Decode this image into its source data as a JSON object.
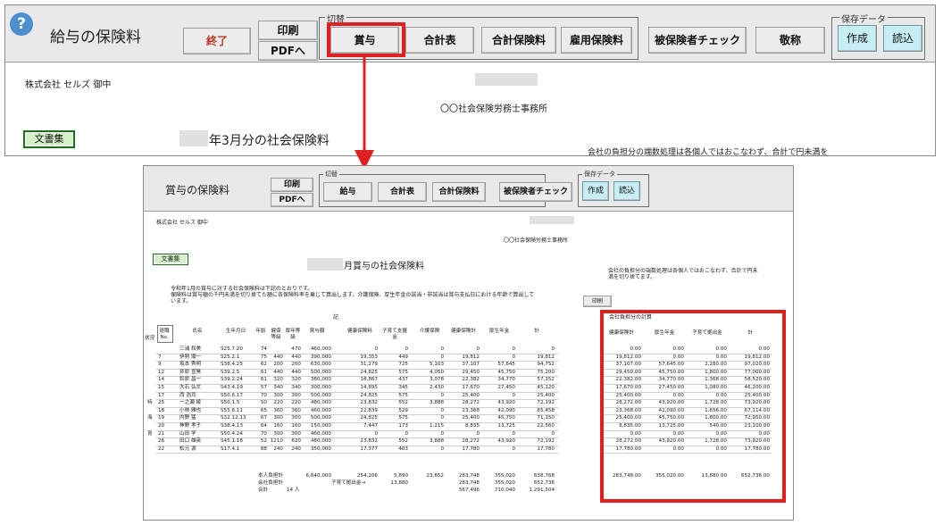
{
  "top": {
    "title": "給与の保険料",
    "help_icon": "?",
    "buttons": {
      "exit": "終了",
      "print": "印刷",
      "pdf": "PDFへ",
      "bonus": "賞与",
      "total_table": "合計表",
      "total_insurance": "合計保険料",
      "employment_insurance": "雇用保険料",
      "insured_check": "被保険者チェック",
      "honorific": "敬称",
      "create": "作成",
      "load": "読込"
    },
    "switch_group_label": "切替",
    "save_group_label": "保存データ",
    "company": "株式会社 セルズ 御中",
    "office": "〇〇社会保険労務士事務所",
    "bunsho_button": "文書集",
    "heading": "年3月分の社会保険料",
    "note": "会社の負担分の端数処理は各個人ではおこなわず、合計で円未満を"
  },
  "bottom": {
    "title": "賞与の保険料",
    "buttons": {
      "print": "印刷",
      "pdf": "PDFへ",
      "salary": "給与",
      "total_table": "合計表",
      "total_insurance": "合計保険料",
      "insured_check": "被保険者チェック",
      "create": "作成",
      "load": "読込",
      "print_small": "印刷"
    },
    "switch_group_label": "切替",
    "save_group_label": "保存データ",
    "company": "株式会社 セルズ 御中",
    "office": "〇〇社会保険労務士事務所",
    "bunsho_button": "文書集",
    "heading": "月賞与の社会保険料",
    "intro_line1": "令和年1月の賞与に対する社会保険料は下記のとおりです。",
    "intro_line2": "保険料は賞与額の千円未満を切り捨てた額に各保険料率を乗じて算出します。介護保険、厚生年金の該当・非該当は賞与支払日における年齢で算出して",
    "intro_line3": "います。",
    "ki": "記",
    "note_right": "会社の負担分の端数処理は各個人ではおこなわず、合計で円未満を切り捨てます。",
    "right_table_title": "会社負担分の計算",
    "status_label": "状況",
    "table_headers": [
      "退職No.",
      "氏名",
      "生年月日",
      "年齢",
      "健保等級",
      "厚年等級",
      "賞与額",
      "健康保険料",
      "子育て支援金",
      "介護保険",
      "健康保険計",
      "厚生年金",
      "計"
    ],
    "right_headers": [
      "健康保険計",
      "厚生年金",
      "子育て拠出金",
      "計"
    ],
    "status_marks": [
      "特",
      "海",
      "育"
    ],
    "rows": [
      [
        "",
        "三浦 和美",
        "S25.7.20",
        "74",
        "",
        "470",
        "460,000",
        "0",
        "0",
        "0",
        "0",
        "0",
        "0"
      ],
      [
        "7",
        "伊勢 順一",
        "S25.2.1",
        "75",
        "440",
        "440",
        "390,000",
        "19,353",
        "449",
        "0",
        "19,812",
        "0",
        "19,812"
      ],
      [
        "9",
        "坂本 秀明",
        "S38.4.25",
        "62",
        "200",
        "200",
        "630,000",
        "31,279",
        "725",
        "5,103",
        "37,107",
        "57,645",
        "94,752"
      ],
      [
        "12",
        "井原 宣昊",
        "S39.2.5",
        "61",
        "440",
        "440",
        "500,000",
        "24,825",
        "575",
        "4,050",
        "29,450",
        "45,750",
        "75,200"
      ],
      [
        "14",
        "鈴原 昌一",
        "S39.2.24",
        "61",
        "320",
        "320",
        "380,000",
        "18,867",
        "437",
        "3,078",
        "22,382",
        "34,770",
        "57,152"
      ],
      [
        "15",
        "大石 弘文",
        "S43.4.19",
        "57",
        "340",
        "340",
        "300,000",
        "14,895",
        "345",
        "2,430",
        "17,670",
        "27,450",
        "45,120"
      ],
      [
        "17",
        "西 浩司",
        "S50.6.17",
        "70",
        "300",
        "300",
        "500,000",
        "24,825",
        "575",
        "0",
        "25,400",
        "0",
        "25,400"
      ],
      [
        "25",
        "一之瀬 綾",
        "S50.1.5",
        "50",
        "220",
        "220",
        "480,000",
        "23,832",
        "552",
        "3,888",
        "28,272",
        "43,920",
        "72,192"
      ],
      [
        "18",
        "小林 雅也",
        "S55.6.11",
        "65",
        "360",
        "360",
        "460,000",
        "22,839",
        "529",
        "0",
        "23,368",
        "42,090",
        "65,458"
      ],
      [
        "19",
        "内野 猛",
        "S32.12.13",
        "67",
        "300",
        "300",
        "500,000",
        "24,825",
        "575",
        "0",
        "25,400",
        "45,750",
        "71,150"
      ],
      [
        "20",
        "神野 孝子",
        "S38.4.13",
        "64",
        "160",
        "160",
        "150,000",
        "7,447",
        "173",
        "1,215",
        "8,835",
        "13,725",
        "22,560"
      ],
      [
        "21",
        "山田 学",
        "S50.4.24",
        "70",
        "300",
        "300",
        "460,000",
        "0",
        "0",
        "0",
        "0",
        "0",
        "0"
      ],
      [
        "26",
        "田口 雄英",
        "S45.1.18",
        "52",
        "1210",
        "620",
        "480,000",
        "23,832",
        "552",
        "3,888",
        "28,272",
        "43,920",
        "72,192"
      ],
      [
        "22",
        "松元 源",
        "S17.4.1",
        "88",
        "240",
        "240",
        "350,000",
        "17,377",
        "403",
        "0",
        "17,780",
        "0",
        "17,780"
      ]
    ],
    "right_rows": [
      [
        "0.00",
        "0.00",
        "0.00",
        "0.00"
      ],
      [
        "19,812.00",
        "0.00",
        "0.00",
        "19,812.00"
      ],
      [
        "37,107.00",
        "57,645.00",
        "2,280.00",
        "97,020.00"
      ],
      [
        "29,450.00",
        "45,750.00",
        "1,800.00",
        "77,000.00"
      ],
      [
        "22,382.00",
        "34,770.00",
        "1,368.00",
        "58,520.00"
      ],
      [
        "17,670.00",
        "27,450.00",
        "1,080.00",
        "46,200.00"
      ],
      [
        "25,400.00",
        "0.00",
        "0.00",
        "25,400.00"
      ],
      [
        "28,272.00",
        "43,920.00",
        "1,728.00",
        "73,920.00"
      ],
      [
        "23,368.00",
        "42,090.00",
        "1,656.00",
        "67,114.00"
      ],
      [
        "25,400.00",
        "45,750.00",
        "1,800.00",
        "72,950.00"
      ],
      [
        "8,835.00",
        "13,725.00",
        "540.00",
        "23,100.00"
      ],
      [
        "0.00",
        "0.00",
        "0.00",
        "0.00"
      ],
      [
        "28,272.00",
        "43,920.00",
        "1,728.00",
        "73,920.00"
      ],
      [
        "17,780.00",
        "0.00",
        "0.00",
        "17,780.00"
      ]
    ],
    "totals": {
      "person_label": "本人負担計",
      "company_label": "会社負担計",
      "total_label": "合計",
      "count": "14 人",
      "child_label": "子育て拠出金→",
      "person_values": [
        "6,640,000",
        "254,206",
        "5,890",
        "23,652",
        "283,748",
        "355,020",
        "638,768"
      ],
      "company_values": [
        "13,880",
        "283,748",
        "355,020",
        "652,736"
      ],
      "total_values": [
        "567,496",
        "710,040",
        "1,291,504"
      ],
      "right_totals": [
        "283,748.00",
        "355,020.00",
        "13,880.00",
        "652,736.00"
      ]
    }
  },
  "colors": {
    "highlight": "#e02020",
    "accent_blue": "#4d8fd1",
    "exit_red": "#c0392b",
    "bunsho_green": "#1f6b1f"
  }
}
